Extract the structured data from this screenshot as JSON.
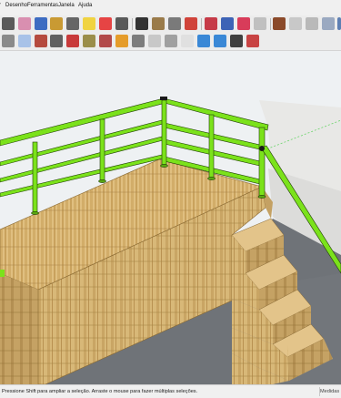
{
  "menu": {
    "items": [
      "Desenho",
      "Ferramentas",
      "Janela",
      "Ajuda"
    ]
  },
  "toolbar1": {
    "icons": [
      "pencil-icon",
      "erase-icon",
      "paint-icon",
      "ruler-icon",
      "protractor-icon",
      "dimension-icon",
      "push-pull-icon",
      "move-icon",
      "rotate-icon",
      "scale-icon",
      "offset-icon",
      "zoom-icon",
      "component-icon",
      "cut-icon",
      "display-icon",
      "camera-icon",
      "walk-icon",
      "position-icon",
      "look-icon",
      "sandbox-icon",
      "shade-icon",
      "fog-icon",
      "style-icon",
      "iso-view-icon",
      "top-view-icon",
      "front-view-icon",
      "right-view-icon",
      "back-view-icon",
      "left-view-icon",
      "xray-view-icon"
    ]
  },
  "toolbar2": {
    "icons": [
      "select-icon",
      "tape-icon",
      "text-icon",
      "axes-icon",
      "paint-bucket-icon",
      "components-icon",
      "3d-text-icon",
      "section-icon",
      "orbit-icon",
      "pan-icon",
      "zoom-window-icon",
      "zoom-extents-icon",
      "prev-view-icon",
      "next-view-icon",
      "warehouse-icon",
      "extension-icon",
      "layout-icon"
    ]
  },
  "status": {
    "hint": "Pressione Shift para ampliar a seleção. Arraste o mouse para fazer múltiplas seleções.",
    "measure_label": "Medidas"
  },
  "colors": {
    "railing": "#7be21b",
    "wood": "#d9b674",
    "floor": "#6f7378",
    "wall": "#e8e8e6",
    "sky": "#eef1f3"
  }
}
